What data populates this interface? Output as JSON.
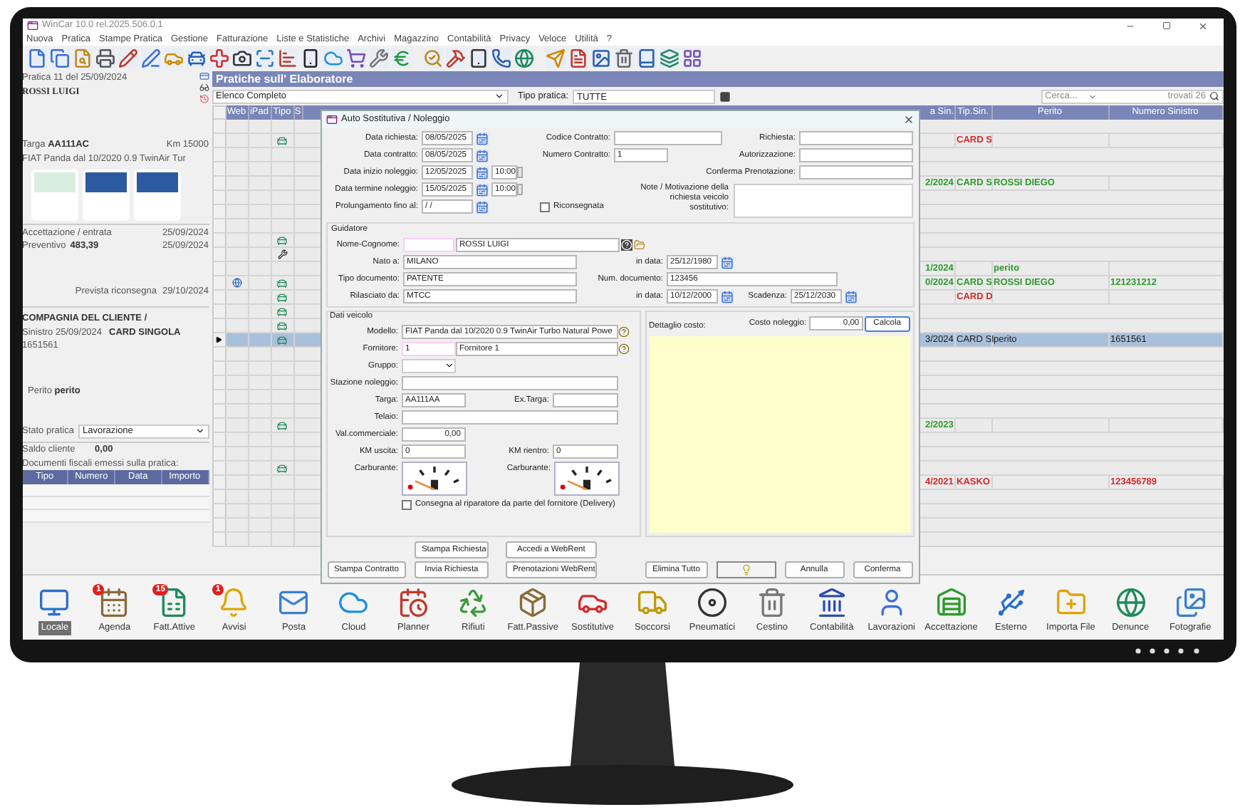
{
  "window": {
    "title": "WinCar 10.0 rel.2025.506.0.1"
  },
  "menu": [
    "Nuova",
    "Pratica",
    "Stampe Pratica",
    "Gestione",
    "Fatturazione",
    "Liste e Statistiche",
    "Archivi",
    "Magazzino",
    "Contabilità",
    "Privacy",
    "Veloce",
    "Utilità",
    "?"
  ],
  "left_panel": {
    "pratica": "Pratica 11 del 25/09/2024",
    "cliente": "ROSSI LUIGI",
    "targa_label": "Targa",
    "targa": "AA111AC",
    "km": "Km 15000",
    "modello": "FIAT Panda dal 10/2020 0.9 TwinAir Tur",
    "dates": [
      {
        "label": "Accettazione / entrata",
        "date": "25/09/2024"
      },
      {
        "label": "Preventivo",
        "value": "483,39",
        "date": "25/09/2024"
      }
    ],
    "riconsegna_label": "Prevista riconsegna",
    "riconsegna": "29/10/2024",
    "compagnia": "COMPAGNIA DEL CLIENTE /",
    "sinistro_label": "Sinistro",
    "sinistro_date": "25/09/2024",
    "sinistro_tipo": "CARD SINGOLA",
    "sinistro_num": "1651561",
    "perito_label": "Perito",
    "perito": "perito",
    "stato_label": "Stato pratica",
    "stato": "Lavorazione",
    "saldo_label": "Saldo cliente",
    "saldo": "0,00",
    "documenti": "Documenti fiscali emessi sulla pratica:",
    "doc_columns": [
      "Tipo",
      "Numero",
      "Data",
      "Importo"
    ]
  },
  "main": {
    "title": "Pratiche sull' Elaboratore",
    "list": "Elenco Completo",
    "tipo_label": "Tipo pratica:",
    "tipo": "TUTTE",
    "search_placeholder": "Cerca...",
    "found": "trovati 26",
    "left_columns": [
      "Web",
      "iPad",
      "Tipo",
      "S"
    ],
    "right_columns": [
      "a Sin.",
      "Tip.Sin.",
      "Perito",
      "Numero Sinistro"
    ],
    "rows": [
      {
        "selected": false,
        "web": false,
        "kind": "none"
      },
      {
        "selected": false,
        "web": false,
        "kind": "car",
        "color": "#d42a2a",
        "cells": [
          "",
          "CARD S",
          "",
          ""
        ]
      },
      {
        "selected": false,
        "web": false,
        "kind": "none"
      },
      {
        "selected": false,
        "web": false,
        "kind": "none"
      },
      {
        "selected": false,
        "web": false,
        "kind": "none",
        "color": "#2e9a2e",
        "cells": [
          "2/2024",
          "CARD S",
          "ROSSI DIEGO",
          ""
        ]
      },
      {
        "selected": false,
        "web": false,
        "kind": "none"
      },
      {
        "selected": false,
        "web": false,
        "kind": "none"
      },
      {
        "selected": false,
        "web": false,
        "kind": "none"
      },
      {
        "selected": false,
        "web": false,
        "kind": "car"
      },
      {
        "selected": false,
        "web": false,
        "kind": "tool"
      },
      {
        "selected": false,
        "web": false,
        "kind": "none",
        "color": "#2e9a2e",
        "cells": [
          "1/2024",
          "",
          "perito",
          ""
        ]
      },
      {
        "selected": false,
        "web": true,
        "kind": "car",
        "color": "#2e9a2e",
        "cells": [
          "0/2024",
          "CARD S",
          "ROSSI DIEGO",
          "121231212"
        ]
      },
      {
        "selected": false,
        "web": false,
        "kind": "car",
        "color": "#d42a2a",
        "cells": [
          "",
          "CARD D",
          "",
          ""
        ]
      },
      {
        "selected": false,
        "web": false,
        "kind": "car"
      },
      {
        "selected": false,
        "web": false,
        "kind": "car"
      },
      {
        "selected": true,
        "web": false,
        "kind": "car",
        "cells": [
          "3/2024",
          "CARD SI",
          "perito",
          "1651561"
        ]
      },
      {
        "selected": false,
        "web": false,
        "kind": "none"
      },
      {
        "selected": false,
        "web": false,
        "kind": "none"
      },
      {
        "selected": false,
        "web": false,
        "kind": "none"
      },
      {
        "selected": false,
        "web": false,
        "kind": "none"
      },
      {
        "selected": false,
        "web": false,
        "kind": "none"
      },
      {
        "selected": false,
        "web": false,
        "kind": "car",
        "color": "#2e9a2e",
        "cells": [
          "2/2023",
          "",
          "",
          ""
        ]
      },
      {
        "selected": false,
        "web": false,
        "kind": "none"
      },
      {
        "selected": false,
        "web": false,
        "kind": "none"
      },
      {
        "selected": false,
        "web": false,
        "kind": "car"
      },
      {
        "selected": false,
        "web": false,
        "kind": "none",
        "color": "#d42a2a",
        "cells": [
          "4/2021",
          "KASKO",
          "",
          "123456789"
        ]
      },
      {
        "selected": false,
        "web": false,
        "kind": "none"
      },
      {
        "selected": false,
        "web": false,
        "kind": "none"
      },
      {
        "selected": false,
        "web": false,
        "kind": "none"
      },
      {
        "selected": false,
        "web": false,
        "kind": "none"
      }
    ]
  },
  "dialog": {
    "title": "Auto Sostitutiva / Noleggio",
    "dates": [
      {
        "label": "Data richiesta:",
        "value": "08/05/2025"
      },
      {
        "label": "Data contratto:",
        "value": "08/05/2025"
      },
      {
        "label": "Data inizio noleggio:",
        "value": "12/05/2025",
        "time": "10:00"
      },
      {
        "label": "Data termine noleggio:",
        "value": "15/05/2025",
        "time": "10:00"
      },
      {
        "label": "Prolungamento fino al:",
        "value": "  /  /"
      }
    ],
    "codice_label": "Codice Contratto:",
    "numero_label": "Numero Contratto:",
    "numero": "1",
    "right_fields": [
      "Richiesta:",
      "Autorizzazione:",
      "Conferma Prenotazione:"
    ],
    "riconsegnata": {
      "label": "Riconsegnata",
      "checked": false
    },
    "note_label": "Note / Motivazione della richiesta veicolo sostitutivo:",
    "guidatore": {
      "title": "Guidatore",
      "nome_label": "Nome-Cognome:",
      "nome": "ROSSI LUIGI",
      "nato_label": "Nato a:",
      "nato": "MILANO",
      "nato_data_label": "in data:",
      "nato_data": "25/12/1980",
      "doc_label": "Tipo documento:",
      "doc": "PATENTE",
      "num_label": "Num. documento:",
      "num": "123456",
      "ril_label": "Rilasciato da:",
      "ril": "MTCC",
      "ril_data_label": "in data:",
      "ril_data": "10/12/2000",
      "scad_label": "Scadenza:",
      "scad": "25/12/2030"
    },
    "veicolo": {
      "title": "Dati veicolo",
      "modello_label": "Modello:",
      "modello": "FIAT Panda dal 10/2020 0.9 TwinAir Turbo Natural Powe",
      "fornitore_label": "Fornitore:",
      "fornitore_code": "1",
      "fornitore": "Fornitore 1",
      "gruppo_label": "Gruppo:",
      "stazione_label": "Stazione noleggio:",
      "targa_label": "Targa:",
      "targa": "AA111AA",
      "ex_targa_label": "Ex.Targa:",
      "telaio_label": "Telaio:",
      "val_label": "Val.commerciale:",
      "val": "0,00",
      "km_uscita_label": "KM uscita:",
      "km_uscita": "0",
      "km_rientro_label": "KM rientro:",
      "km_rientro": "0",
      "fuel": [
        {
          "label": "Carburante:"
        },
        {
          "label": "Carburante:"
        }
      ],
      "delivery": {
        "label": "Consegna al riparatore da parte del fornitore (Delivery)",
        "checked": false
      }
    },
    "costo": {
      "dettaglio_label": "Dettaglio costo:",
      "label": "Costo noleggio:",
      "value": "0,00",
      "button": "Calcola"
    },
    "buttons_left": [
      "Stampa Contratto",
      "Stampa Richiesta",
      "Invia Richiesta"
    ],
    "buttons_web": [
      "Accedi a WebRent",
      "Prenotazioni WebRent"
    ],
    "buttons_right": [
      "Elimina Tutto",
      "Annulla",
      "Conferma"
    ]
  },
  "taskbar": [
    {
      "label": "Locale",
      "selected": true
    },
    {
      "label": "Agenda",
      "selected": false,
      "badge": "1"
    },
    {
      "label": "Fatt.Attive",
      "selected": false,
      "badge": "15"
    },
    {
      "label": "Avvisi",
      "selected": false,
      "badge": "1"
    },
    {
      "label": "Posta",
      "selected": false
    },
    {
      "label": "Cloud",
      "selected": false
    },
    {
      "label": "Planner",
      "selected": false
    },
    {
      "label": "Rifiuti",
      "selected": false
    },
    {
      "label": "Fatt.Passive",
      "selected": false
    },
    {
      "label": "Sostitutive",
      "selected": false
    },
    {
      "label": "Soccorsi",
      "selected": false
    },
    {
      "label": "Pneumatici",
      "selected": false
    },
    {
      "label": "Cestino",
      "selected": false
    },
    {
      "label": "Contabilità",
      "selected": false
    },
    {
      "label": "Lavorazioni",
      "selected": false
    },
    {
      "label": "Accettazione",
      "selected": false
    },
    {
      "label": "Esterno",
      "selected": false
    },
    {
      "label": "Importa File",
      "selected": false
    },
    {
      "label": "Denunce",
      "selected": false
    },
    {
      "label": "Fotografie",
      "selected": false
    }
  ]
}
